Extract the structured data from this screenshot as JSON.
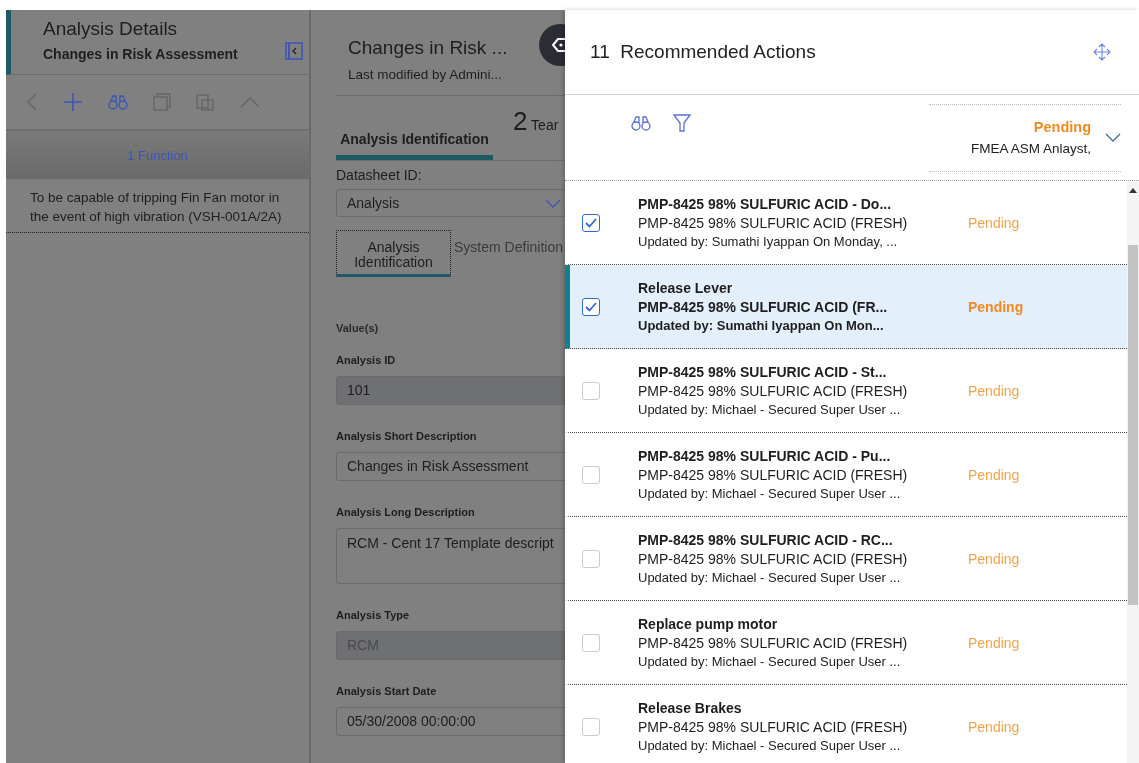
{
  "analysis_panel": {
    "title": "Analysis Details",
    "subtitle": "Changes in Risk Assessment",
    "function_header": "1 Function",
    "functions": [
      {
        "text": "To be capable of tripping Fin Fan motor in the event of high vibration (VSH-001A/2A)"
      }
    ]
  },
  "detail_panel": {
    "title": "Changes in Risk ...",
    "modified": "Last modified by Admini...",
    "tabs": [
      {
        "label": "Analysis Identification",
        "selected": true
      },
      {
        "count": "2",
        "label": "Tear",
        "selected": false
      }
    ],
    "datasheet_label": "Datasheet ID:",
    "datasheet_value": "Analysis",
    "subtabs": [
      {
        "label": "Analysis Identification",
        "selected": true
      },
      {
        "label": "System Definition",
        "selected": false
      }
    ],
    "values_heading": "Value(s)",
    "fields": [
      {
        "label": "Analysis ID",
        "value": "101",
        "kind": "input",
        "readonly": true,
        "disabled": false
      },
      {
        "label": "Analysis Short Description",
        "value": "Changes in Risk Assessment",
        "kind": "input",
        "readonly": false,
        "disabled": false
      },
      {
        "label": "Analysis Long Description",
        "value": "RCM - Cent 17 Template descript",
        "kind": "textarea",
        "readonly": false,
        "disabled": false
      },
      {
        "label": "Analysis Type",
        "value": "RCM",
        "kind": "input",
        "readonly": true,
        "disabled": true
      },
      {
        "label": "Analysis Start Date",
        "value": "05/30/2008 00:00:00",
        "kind": "input",
        "readonly": false,
        "disabled": false
      }
    ]
  },
  "actions_panel": {
    "count": "11",
    "title": "Recommended Actions",
    "filter_status": "Pending",
    "filter_assignee": "FMEA ASM Anlayst,",
    "actions": [
      {
        "title": "PMP-8425 98% SULFURIC ACID - Do...",
        "subtitle": "PMP-8425 98% SULFURIC ACID (FRESH)",
        "updated": "Updated by: Sumathi Iyappan On  Monday, ...",
        "status": "Pending",
        "checked": true,
        "selected": false
      },
      {
        "title": "Release Lever",
        "subtitle": "PMP-8425 98% SULFURIC ACID (FR...",
        "updated": "Updated by: Sumathi Iyappan On  Mon...",
        "status": "Pending",
        "checked": true,
        "selected": true
      },
      {
        "title": "PMP-8425 98% SULFURIC ACID - St...",
        "subtitle": "PMP-8425 98% SULFURIC ACID (FRESH)",
        "updated": "Updated by: Michael - Secured Super User ...",
        "status": "Pending",
        "checked": false,
        "selected": false
      },
      {
        "title": "PMP-8425 98% SULFURIC ACID - Pu...",
        "subtitle": "PMP-8425 98% SULFURIC ACID (FRESH)",
        "updated": "Updated by: Michael - Secured Super User ...",
        "status": "Pending",
        "checked": false,
        "selected": false
      },
      {
        "title": "PMP-8425 98% SULFURIC ACID - RC...",
        "subtitle": "PMP-8425 98% SULFURIC ACID (FRESH)",
        "updated": "Updated by: Michael - Secured Super User ...",
        "status": "Pending",
        "checked": false,
        "selected": false
      },
      {
        "title": "Replace pump motor",
        "subtitle": "PMP-8425 98% SULFURIC ACID (FRESH)",
        "updated": "Updated by: Michael - Secured Super User ...",
        "status": "Pending",
        "checked": false,
        "selected": false
      },
      {
        "title": "Release Brakes",
        "subtitle": "PMP-8425 98% SULFURIC ACID (FRESH)",
        "updated": "Updated by: Michael - Secured Super User ...",
        "status": "Pending",
        "checked": false,
        "selected": false
      }
    ]
  }
}
